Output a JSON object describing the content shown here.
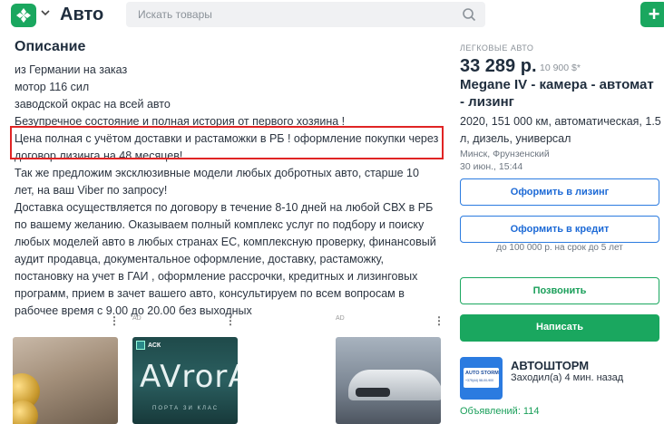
{
  "header": {
    "brand": "Авто",
    "search_placeholder": "Искать товары",
    "add_label": "+"
  },
  "description": {
    "title": "Описание",
    "lines": [
      "из Германии на заказ",
      "мотор 116 сил",
      "заводской окрас на всей авто",
      "Безупречное состояние и полная история от первого хозяина !",
      "Цена полная с учётом доставки и растаможки в РБ ! оформление покупки через",
      "договор лизинга на 48 месяцев!",
      "Так же предложим эксклюзивные модели любых добротных авто, старше 10",
      "лет, на ваш Viber по запросу!",
      "Доставка осуществляется по договору в течение 8-10 дней на любой СВХ в РБ",
      "по вашему желанию. Оказываем полный комплекс услуг по подбору и поиску",
      "любых моделей авто в любых странах ЕС, комплексную проверку, финансовый",
      "аудит продавца, документальное оформление, доставку, растаможку,",
      "постановку на учет в ГАИ , оформление рассрочки, кредитных и лизинговых",
      "программ, прием в зачет вашего авто, консультируем по всем вопросам в",
      "рабочее время с 9.00 до 20.00 без выходных"
    ]
  },
  "cards": [
    {
      "ad": "",
      "dots": "⋮"
    },
    {
      "ad": "AD",
      "dots": "⋮",
      "logo_text": "АСК",
      "title": "AVrorA",
      "subtitle": "ПОРТА ЗИ КЛАС"
    },
    {
      "ad": "AD",
      "dots": "⋮"
    }
  ],
  "listing": {
    "category": "ЛЕГКОВЫЕ АВТО",
    "price": "33 289 р.",
    "price_usd": "10 900 $*",
    "title_lines": [
      "Megane IV - камера - автомат",
      "- лизинг"
    ],
    "specs_lines": [
      "2020, 151 000 км, автоматическая, 1.5",
      "л, дизель, универсал"
    ],
    "location": "Минск, Фрунзенский",
    "date": "30 июн., 15:44"
  },
  "buttons": {
    "leasing": "Оформить в лизинг",
    "credit": "Оформить в кредит",
    "credit_note": "до 100 000 р. на срок до 5 лет",
    "call": "Позвонить",
    "message": "Написать"
  },
  "seller": {
    "name": "АВТОШТОРМ",
    "status": "Заходил(а) 4 мин. назад",
    "ads": "Объявлений: 114",
    "logo_text": "AUTO STORM",
    "logo_phone": "+375(44) 58-00-900"
  },
  "colors": {
    "brand_green": "#1aa75f",
    "link_blue": "#2b7be0",
    "highlight_red": "#e02424"
  },
  "icons": {
    "logo": "kufar-logo-icon",
    "search": "search-icon",
    "menu_dots": "more-vert-icon"
  }
}
